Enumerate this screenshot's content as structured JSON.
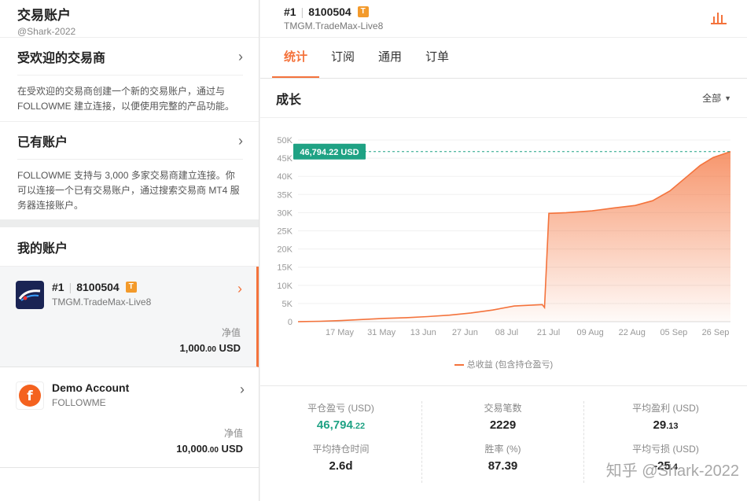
{
  "left": {
    "title": "交易账户",
    "handle": "@Shark-2022",
    "popular": {
      "title": "受欢迎的交易商",
      "desc": "在受欢迎的交易商创建一个新的交易账户，通过与 FOLLOWME 建立连接，以便使用完整的产品功能。"
    },
    "existing": {
      "title": "已有账户",
      "desc": "FOLLOWME 支持与 3,000 多家交易商建立连接。你可以连接一个已有交易账户，通过搜索交易商 MT4 服务器连接账户。"
    },
    "my_accounts": {
      "title": "我的账户",
      "accounts": [
        {
          "num": "#1",
          "id": "8100504",
          "badge": "T",
          "server": "TMGM.TradeMax-Live8",
          "eq_label": "净值",
          "eq_main": "1,000",
          "eq_dec": ".00",
          "eq_cur": " USD"
        },
        {
          "name": "Demo Account",
          "server": "FOLLOWME",
          "eq_label": "净值",
          "eq_main": "10,000",
          "eq_dec": ".00",
          "eq_cur": " USD"
        }
      ]
    }
  },
  "header": {
    "num": "#1",
    "id": "8100504",
    "badge": "T",
    "server": "TMGM.TradeMax-Live8"
  },
  "tabs": [
    "统计",
    "订阅",
    "通用",
    "订单"
  ],
  "card": {
    "title": "成长",
    "filter": "全部"
  },
  "chart_data": {
    "type": "area",
    "y_ticks": [
      "0",
      "5K",
      "10K",
      "15K",
      "20K",
      "25K",
      "30K",
      "35K",
      "40K",
      "45K",
      "50K"
    ],
    "ylim": [
      0,
      50000
    ],
    "x_ticks": [
      "17 May",
      "31 May",
      "13 Jun",
      "27 Jun",
      "08 Jul",
      "21 Jul",
      "09 Aug",
      "22 Aug",
      "05 Sep",
      "26 Sep"
    ],
    "last_value_label": "46,794.22 USD",
    "legend": "总收益 (包含持仓盈亏)",
    "color": "#f4733c",
    "points": [
      [
        0,
        0
      ],
      [
        0.05,
        100
      ],
      [
        0.1,
        300
      ],
      [
        0.15,
        600
      ],
      [
        0.2,
        900
      ],
      [
        0.25,
        1100
      ],
      [
        0.3,
        1400
      ],
      [
        0.35,
        1800
      ],
      [
        0.4,
        2400
      ],
      [
        0.45,
        3200
      ],
      [
        0.5,
        4300
      ],
      [
        0.55,
        4600
      ],
      [
        0.565,
        4700
      ],
      [
        0.57,
        3900
      ],
      [
        0.58,
        29800
      ],
      [
        0.62,
        30000
      ],
      [
        0.68,
        30500
      ],
      [
        0.73,
        31300
      ],
      [
        0.78,
        32000
      ],
      [
        0.82,
        33300
      ],
      [
        0.86,
        36000
      ],
      [
        0.9,
        40000
      ],
      [
        0.93,
        43000
      ],
      [
        0.96,
        45200
      ],
      [
        1.0,
        46794.22
      ]
    ]
  },
  "stats": [
    [
      {
        "label": "平仓盈亏 (USD)",
        "main": "46,794",
        "dec": ".22",
        "green": true
      },
      {
        "label": "平均持仓时间",
        "main": "2.6d",
        "dec": ""
      }
    ],
    [
      {
        "label": "交易笔数",
        "main": "2229",
        "dec": ""
      },
      {
        "label": "胜率 (%)",
        "main": "87.39",
        "dec": ""
      }
    ],
    [
      {
        "label": "平均盈利 (USD)",
        "main": "29",
        "dec": ".13"
      },
      {
        "label": "平均亏损 (USD)",
        "main": "-25",
        "dec": ".4"
      }
    ]
  ],
  "watermark": "知乎 @Shark-2022"
}
